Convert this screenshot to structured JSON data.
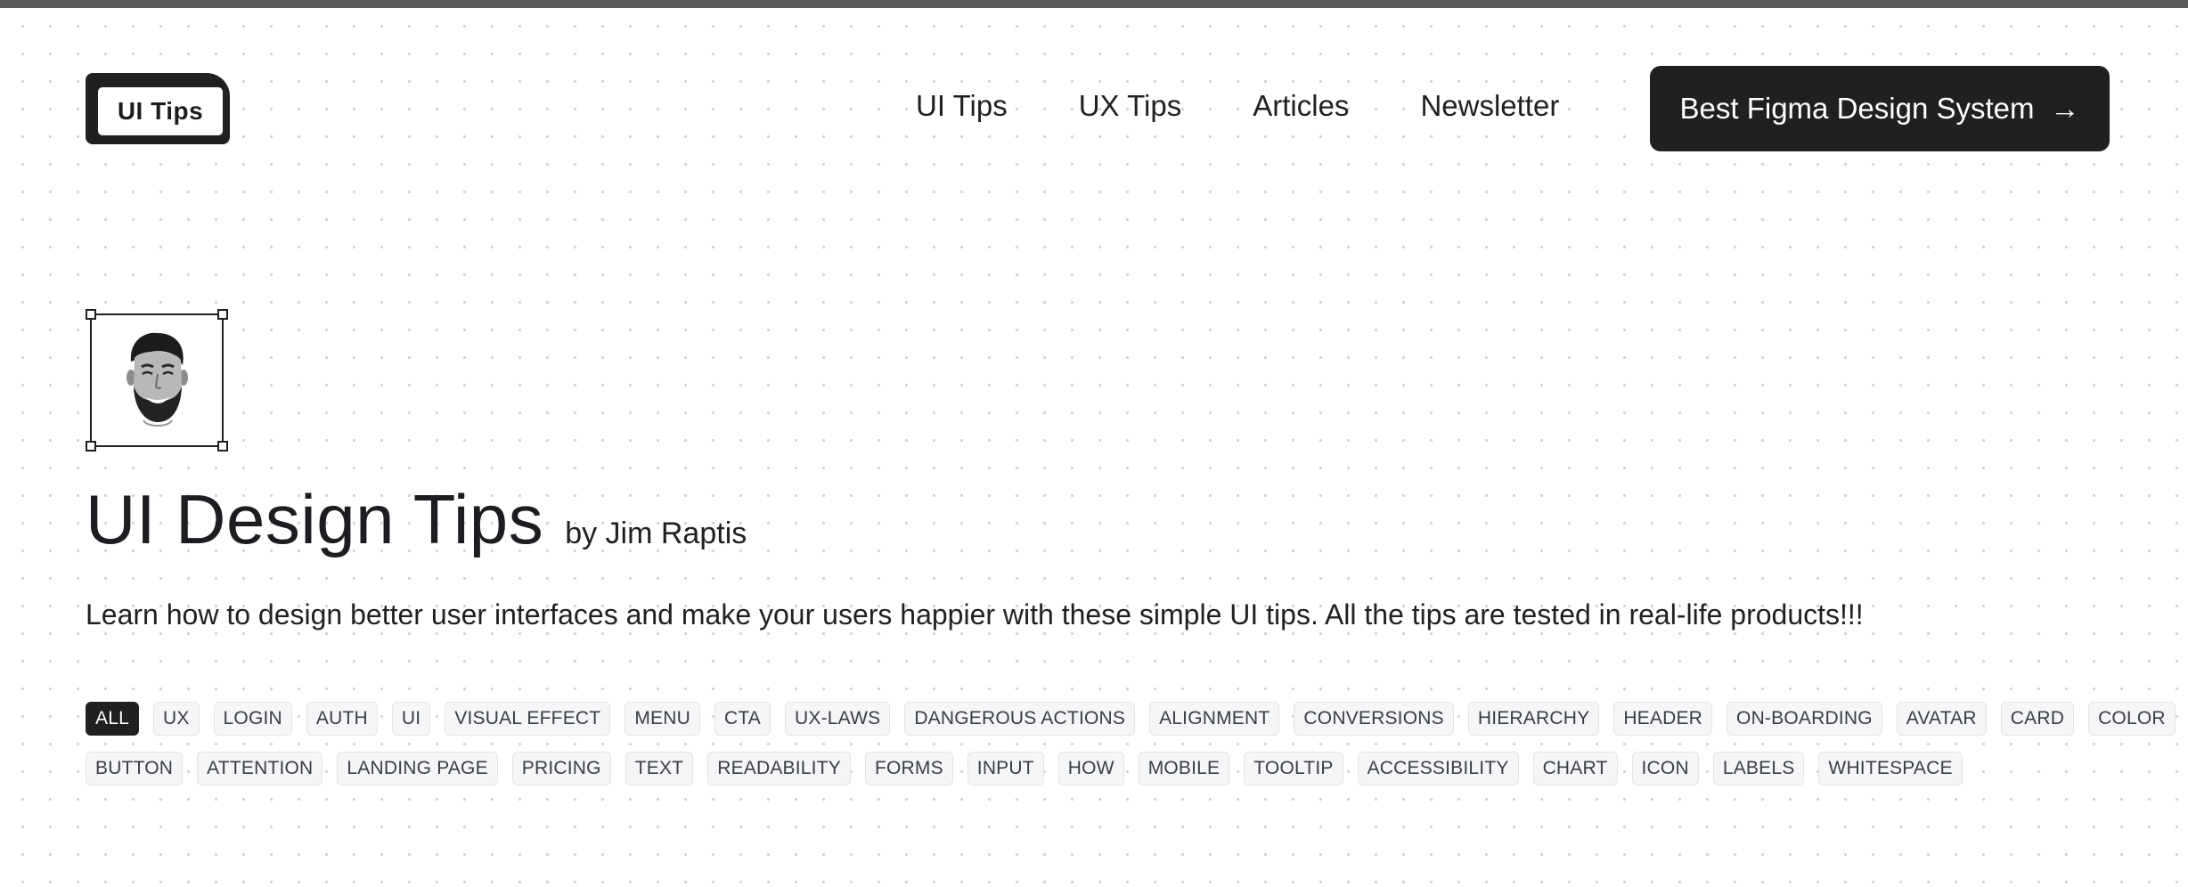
{
  "logo": {
    "text": "UI Tips"
  },
  "nav": {
    "items": [
      "UI Tips",
      "UX Tips",
      "Articles",
      "Newsletter"
    ]
  },
  "cta": {
    "label": "Best Figma Design System",
    "arrow": "→"
  },
  "avatar": {
    "icon": "avatar-photo"
  },
  "hero": {
    "title": "UI Design Tips",
    "byline": "by Jim Raptis",
    "description": "Learn how to design better user interfaces and make your users happier with these simple UI tips. All the tips are tested in real-life products!!!"
  },
  "tags": {
    "row1": [
      "ALL",
      "UX",
      "LOGIN",
      "AUTH",
      "UI",
      "VISUAL EFFECT",
      "MENU",
      "CTA",
      "UX-LAWS",
      "DANGEROUS ACTIONS",
      "ALIGNMENT",
      "CONVERSIONS",
      "HIERARCHY",
      "HEADER",
      "ON-BOARDING",
      "AVATAR",
      "CARD",
      "COLOR"
    ],
    "row2": [
      "BUTTON",
      "ATTENTION",
      "LANDING PAGE",
      "PRICING",
      "TEXT",
      "READABILITY",
      "FORMS",
      "INPUT",
      "HOW",
      "MOBILE",
      "TOOLTIP",
      "ACCESSIBILITY",
      "CHART",
      "ICON",
      "LABELS",
      "WHITESPACE"
    ],
    "selected": "ALL"
  },
  "colors": {
    "dark": "#202022",
    "text": "#1f2023",
    "tag_bg": "#f5f6f7",
    "tag_border": "#e2e4e8"
  }
}
